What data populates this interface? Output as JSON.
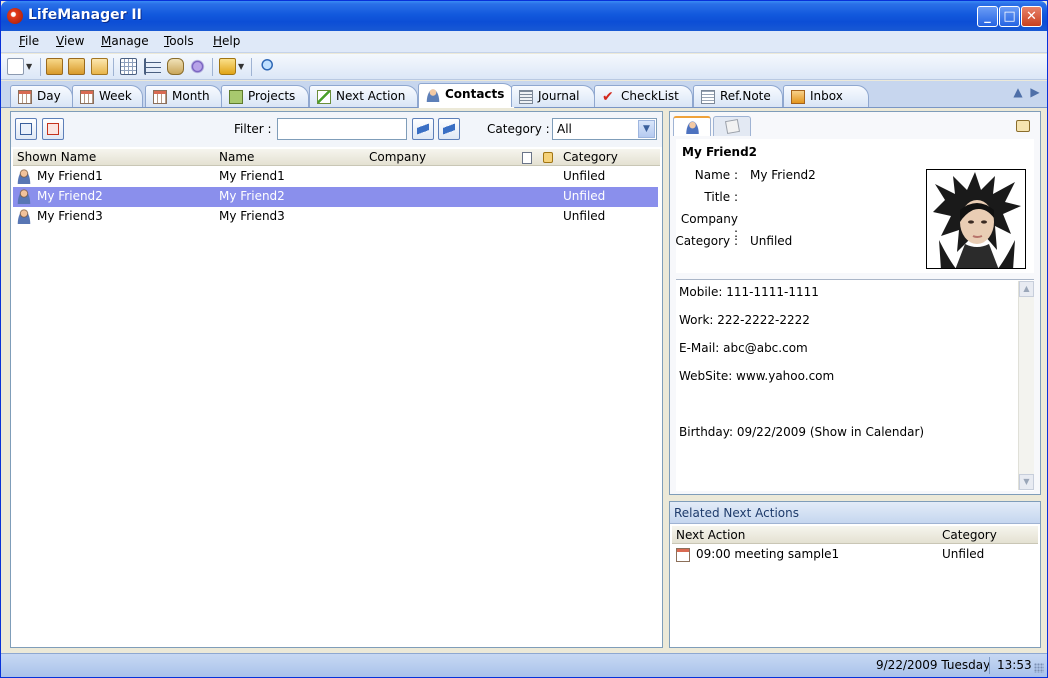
{
  "window": {
    "title": "LifeManager II",
    "controls": {
      "minimize": "_",
      "maximize": "□",
      "close": "✕"
    }
  },
  "menu": [
    "File",
    "View",
    "Manage",
    "Tools",
    "Help"
  ],
  "tabs": [
    {
      "label": "Day",
      "icon": "calendar-day-icon"
    },
    {
      "label": "Week",
      "icon": "calendar-week-icon"
    },
    {
      "label": "Month",
      "icon": "calendar-month-icon"
    },
    {
      "label": "Projects",
      "icon": "projects-icon"
    },
    {
      "label": "Next Action",
      "icon": "next-action-icon"
    },
    {
      "label": "Contacts",
      "icon": "contacts-icon",
      "active": true
    },
    {
      "label": "Journal",
      "icon": "journal-icon"
    },
    {
      "label": "CheckList",
      "icon": "checklist-icon"
    },
    {
      "label": "Ref.Note",
      "icon": "ref-note-icon"
    },
    {
      "label": "Inbox",
      "icon": "inbox-icon"
    }
  ],
  "contacts_panel": {
    "filter_label": "Filter :",
    "filter_value": "",
    "category_label": "Category :",
    "category_value": "All",
    "columns": [
      "Shown Name",
      "Name",
      "Company",
      "Category"
    ],
    "rows": [
      {
        "shown_name": "My Friend1",
        "name": "My Friend1",
        "company": "",
        "category": "Unfiled"
      },
      {
        "shown_name": "My Friend2",
        "name": "My Friend2",
        "company": "",
        "category": "Unfiled",
        "selected": true
      },
      {
        "shown_name": "My Friend3",
        "name": "My Friend3",
        "company": "",
        "category": "Unfiled"
      }
    ]
  },
  "detail": {
    "heading": "My Friend2",
    "labels": {
      "name": "Name :",
      "title": "Title :",
      "company": "Company :",
      "category": "Category :"
    },
    "values": {
      "name": "My Friend2",
      "title": "",
      "company": "",
      "category": "Unfiled"
    },
    "notes": [
      "Mobile: 111-1111-1111",
      "Work: 222-2222-2222",
      "E-Mail: abc@abc.com",
      "WebSite: www.yahoo.com",
      "Birthday: 09/22/2009 (Show in Calendar)"
    ]
  },
  "related": {
    "title": "Related Next Actions",
    "columns": [
      "Next Action",
      "Category"
    ],
    "rows": [
      {
        "action": "09:00 meeting sample1",
        "category": "Unfiled"
      }
    ]
  },
  "status": {
    "date": "9/22/2009 Tuesday",
    "time": "13:53"
  }
}
